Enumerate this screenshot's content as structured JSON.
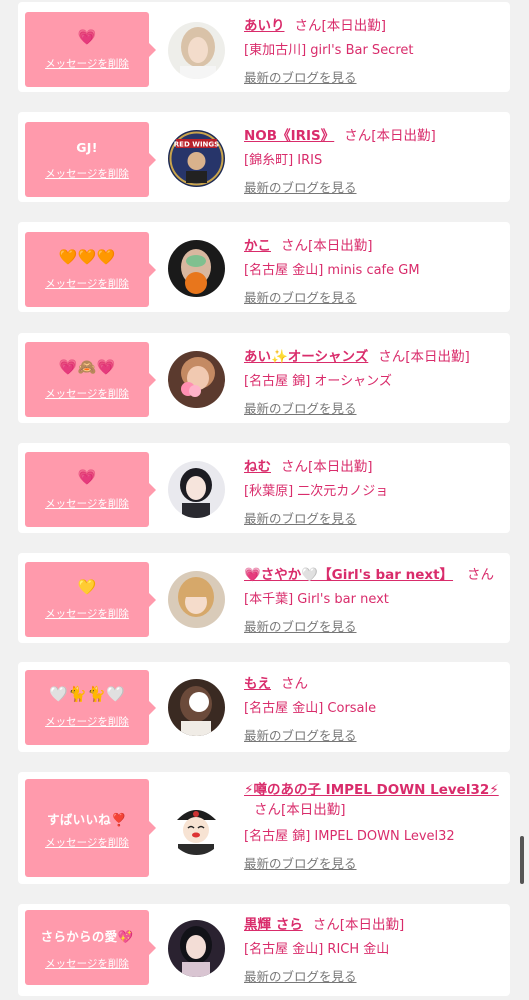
{
  "blog_link_label": "最新のブログを見る",
  "delete_label": "メッセージを削除",
  "san": "さん",
  "colors": {
    "bubble": "#ff9aac",
    "accent": "#d92c6b",
    "background": "#f1f1f1"
  },
  "messages": [
    {
      "message": "💗",
      "name": "あいり",
      "status": "[本日出勤]",
      "shop": "[東加古川] girl's Bar Secret",
      "avatar_icon": "avatar-photo-blonde"
    },
    {
      "message": "GJ!",
      "name": "NOB《IRIS》",
      "status": "[本日出勤]",
      "shop": "[錦糸町] IRIS",
      "avatar_icon": "avatar-red-wings-emblem"
    },
    {
      "message": "🧡🧡🧡",
      "name": "かこ",
      "status": "[本日出勤]",
      "shop": "[名古屋 金山] minis cafe GM",
      "avatar_icon": "avatar-photo-dark-hair"
    },
    {
      "message": "💗🙈💗",
      "name": "あい✨オーシャンズ",
      "status": "[本日出勤]",
      "shop": "[名古屋 錦] オーシャンズ",
      "avatar_icon": "avatar-photo-hearts"
    },
    {
      "message": "💗",
      "name": "ねむ",
      "status": "[本日出勤]",
      "shop": "[秋葉原] 二次元カノジョ",
      "avatar_icon": "avatar-photo-black-hair"
    },
    {
      "message": "💛",
      "name": "💗さやか🤍【Girl's bar next】",
      "status": "",
      "shop": "[本千葉] Girl's bar next",
      "avatar_icon": "avatar-photo-blonde-bangs"
    },
    {
      "message": "🤍🐈🐈🤍",
      "name": "もえ",
      "status": "",
      "shop": "[名古屋 金山] Corsale",
      "avatar_icon": "avatar-photo-brown-hair"
    },
    {
      "message": "すばいいね❣️",
      "name": "⚡噂のあの子 IMPEL DOWN Level32⚡",
      "status": "[本日出勤]",
      "shop": "[名古屋 錦] IMPEL DOWN Level32",
      "avatar_icon": "avatar-cartoon-captain"
    },
    {
      "message": "さらからの愛💖",
      "name": "黒輝 さら",
      "status": "[本日出勤]",
      "shop": "[名古屋 金山] RICH 金山",
      "avatar_icon": "avatar-photo-dark-portrait"
    }
  ]
}
